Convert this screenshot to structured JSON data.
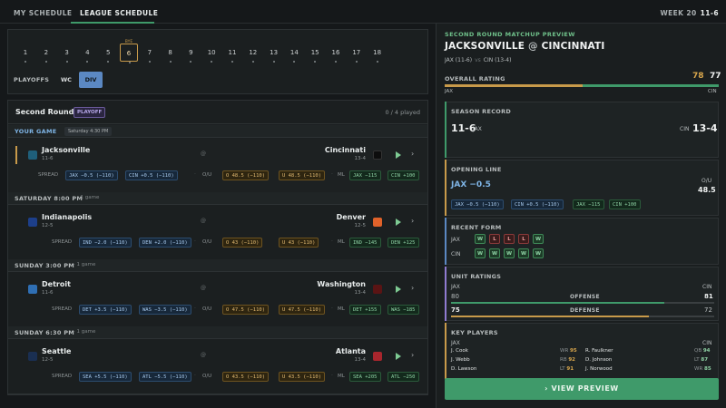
{
  "nav": {
    "tabs": [
      {
        "label": "MY SCHEDULE",
        "active": false
      },
      {
        "label": "LEAGUE SCHEDULE",
        "active": true
      }
    ],
    "week_label": "WEEK 20",
    "user_record": "11-6"
  },
  "weeks": {
    "items": [
      "1",
      "2",
      "3",
      "4",
      "5",
      "6",
      "7",
      "8",
      "9",
      "10",
      "11",
      "12",
      "13",
      "14",
      "15",
      "16",
      "17",
      "18"
    ],
    "selected": "6",
    "bye_label": "BYE",
    "playoffs_label": "PLAYOFFS",
    "playoff_rounds": [
      {
        "label": "WC",
        "active": false
      },
      {
        "label": "DIV",
        "active": true
      }
    ]
  },
  "round": {
    "title": "Second Round",
    "badge": "PLAYOFF",
    "progress": "0 / 4 played"
  },
  "groups": [
    {
      "title": "YOUR GAME",
      "sub": "Saturday 4:30 PM"
    },
    {
      "title": "SATURDAY 8:00 PM",
      "sub": "· 1 game"
    },
    {
      "title": "SUNDAY 3:00 PM",
      "sub": "· 1 game"
    },
    {
      "title": "SUNDAY 6:30 PM",
      "sub": "· 1 game"
    }
  ],
  "games": [
    {
      "away": "Jacksonville",
      "away_rec": "11-6",
      "home": "Cincinnati",
      "home_rec": "13-4",
      "at": "@",
      "away_color": "#1f5f7a",
      "home_color": "#0d0d0d",
      "spread_label": "SPREAD",
      "spread_away": "JAX −0.5 (−110)",
      "spread_home": "CIN +0.5 (−110)",
      "ou_label": "O/U",
      "over": "O 48.5 (−110)",
      "under": "U 48.5 (−110)",
      "ml_label": "ML",
      "ml_away": "JAX −115",
      "ml_home": "CIN +100",
      "dash": "·"
    },
    {
      "away": "Indianapolis",
      "away_rec": "12-5",
      "home": "Denver",
      "home_rec": "12-5",
      "at": "@",
      "away_color": "#1d3f8a",
      "home_color": "#e0622a",
      "spread_label": "SPREAD",
      "spread_away": "IND −2.0 (−110)",
      "spread_home": "DEN +2.0 (−110)",
      "ou_label": "O/U",
      "over": "O 43 (−110)",
      "under": "U 43 (−110)",
      "ml_label": "ML",
      "ml_away": "IND −145",
      "ml_home": "DEN +125",
      "dash": "·"
    },
    {
      "away": "Detroit",
      "away_rec": "11-6",
      "home": "Washington",
      "home_rec": "13-4",
      "at": "@",
      "away_color": "#2f6fb4",
      "home_color": "#5a1414",
      "spread_label": "SPREAD",
      "spread_away": "DET +3.5 (−110)",
      "spread_home": "WAS −3.5 (−110)",
      "ou_label": "O/U",
      "over": "O 47.5 (−110)",
      "under": "U 47.5 (−110)",
      "ml_label": "ML",
      "ml_away": "DET +155",
      "ml_home": "WAS −185",
      "dash": "·"
    },
    {
      "away": "Seattle",
      "away_rec": "12-5",
      "home": "Atlanta",
      "home_rec": "13-4",
      "at": "@",
      "away_color": "#1a2f52",
      "home_color": "#a8262d",
      "spread_label": "SPREAD",
      "spread_away": "SEA +5.5 (−110)",
      "spread_home": "ATL −5.5 (−110)",
      "ou_label": "O/U",
      "over": "O 43.5 (−110)",
      "under": "U 43.5 (−110)",
      "ml_label": "ML",
      "ml_away": "SEA +205",
      "ml_home": "ATL −250",
      "dash": "·"
    }
  ],
  "preview": {
    "title": "SECOND ROUND MATCHUP PREVIEW",
    "away": "JACKSONVILLE",
    "home": "CINCINNATI",
    "at": "@",
    "away_abbr_rec": "JAX (11-6)",
    "vs": "vs",
    "home_abbr_rec": "CIN (13-4)",
    "overall_label": "OVERALL RATING",
    "overall_away": "78",
    "overall_home": "77",
    "overall_share": 0.503,
    "away_abbr": "JAX",
    "home_abbr": "CIN",
    "season_record_label": "SEASON RECORD",
    "away_record": "11-6",
    "home_record": "13-4",
    "opening_line_label": "OPENING LINE",
    "line": "JAX −0.5",
    "ou_label": "O/U",
    "ou_value": "48.5",
    "line_chips": [
      "JAX −0.5 (−110)",
      "CIN +0.5 (−110)",
      "JAX −115",
      "CIN +100"
    ],
    "form_label": "RECENT FORM",
    "form_away": [
      "W",
      "L",
      "L",
      "L",
      "W"
    ],
    "form_home": [
      "W",
      "W",
      "W",
      "W",
      "W"
    ],
    "unit_label": "UNIT RATINGS",
    "offense_label": "OFFENSE",
    "offense_away": "80",
    "offense_home": "81",
    "offense_away_frac": 0.8,
    "offense_home_frac": 0.81,
    "defense_label": "DEFENSE",
    "defense_away": "75",
    "defense_home": "72",
    "defense_away_frac": 0.75,
    "defense_home_frac": 0.72,
    "key_label": "KEY PLAYERS",
    "away_players": [
      {
        "name": "J. Cook",
        "pos": "WR",
        "rating": "95"
      },
      {
        "name": "J. Webb",
        "pos": "RB",
        "rating": "92"
      },
      {
        "name": "D. Lawson",
        "pos": "LT",
        "rating": "91"
      }
    ],
    "home_players": [
      {
        "name": "R. Faulkner",
        "pos": "QB",
        "rating": "94"
      },
      {
        "name": "D. Johnson",
        "pos": "LT",
        "rating": "87"
      },
      {
        "name": "J. Norwood",
        "pos": "WR",
        "rating": "85"
      }
    ],
    "button": "VIEW PREVIEW",
    "button_icon": "›"
  },
  "colors": {
    "accent_green": "#3f9a6a",
    "accent_gold": "#c89a4a",
    "accent_blue": "#5b88c2"
  }
}
